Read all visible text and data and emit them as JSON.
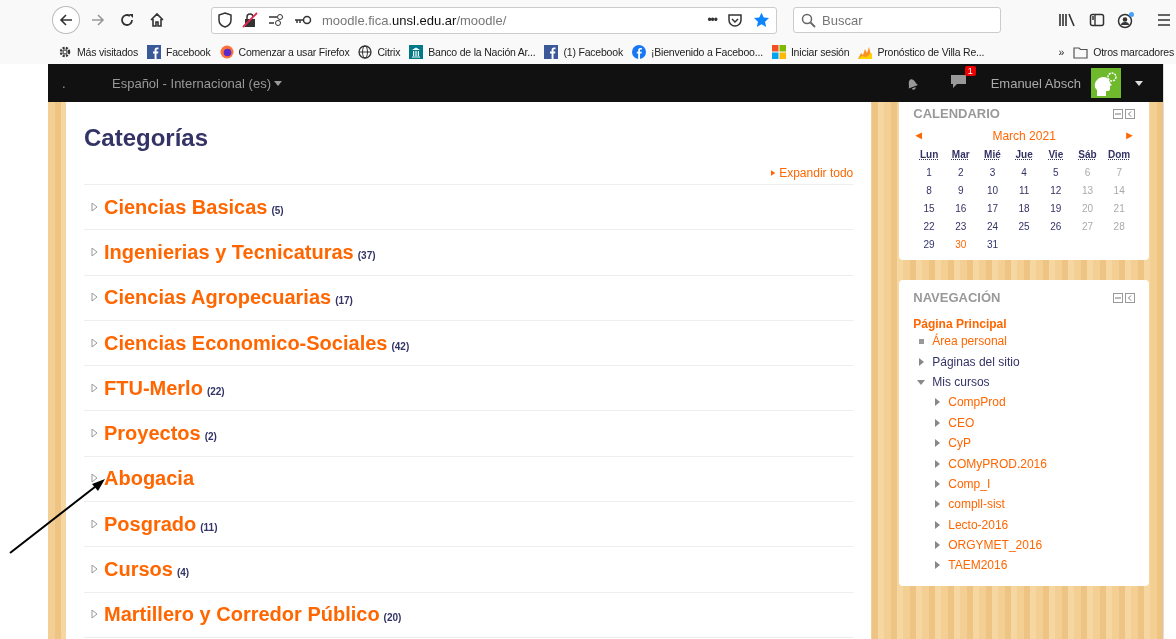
{
  "browser": {
    "url_host_pre": "moodle.fica.",
    "url_host_main": "unsl.edu.ar",
    "url_path": "/moodle/",
    "search_placeholder": "Buscar",
    "more": "•••",
    "bookmarks": [
      {
        "label": "Más visitados"
      },
      {
        "label": "Facebook"
      },
      {
        "label": "Comenzar a usar Firefox"
      },
      {
        "label": "Citrix"
      },
      {
        "label": "Banco de la Nación Ar..."
      },
      {
        "label": "(1) Facebook"
      },
      {
        "label": "¡Bienvenido a Faceboo..."
      },
      {
        "label": "Iniciar sesión"
      },
      {
        "label": "Pronóstico de Villa Re..."
      }
    ],
    "overflow": "»",
    "other_bookmarks": "Otros marcadores"
  },
  "navbar": {
    "brand": ".",
    "language": "Español - Internacional (es)",
    "message_count": "1",
    "user": "Emanuel Absch"
  },
  "main": {
    "title": "Categorías",
    "expand_all": "Expandir todo",
    "categories": [
      {
        "name": "Ciencias Basicas",
        "count": "(5)",
        "expanded": false
      },
      {
        "name": "Ingenierias y Tecnicaturas",
        "count": "(37)",
        "expanded": false
      },
      {
        "name": "Ciencias Agropecuarias",
        "count": "(17)",
        "expanded": false
      },
      {
        "name": "Ciencias Economico-Sociales",
        "count": "(42)",
        "expanded": false
      },
      {
        "name": "FTU-Merlo",
        "count": "(22)",
        "expanded": false
      },
      {
        "name": "Proyectos",
        "count": "(2)",
        "expanded": false
      },
      {
        "name": "Abogacia",
        "expanded": false
      },
      {
        "name": "Posgrado",
        "count": "(11)",
        "expanded": false
      },
      {
        "name": "Cursos",
        "count": "(4)",
        "expanded": false
      },
      {
        "name": "Martillero y Corredor Público",
        "count": "(20)",
        "expanded": false
      }
    ]
  },
  "calendar": {
    "title": "CALENDARIO",
    "prev": "◄",
    "next": "►",
    "month": "March 2021",
    "weekdays": [
      "Lun",
      "Mar",
      "Mié",
      "Jue",
      "Vie",
      "Sáb",
      "Dom"
    ],
    "weeks": [
      [
        {
          "day": "1",
          "kind": "weekday"
        },
        {
          "day": "2",
          "kind": "weekday"
        },
        {
          "day": "3",
          "kind": "weekday"
        },
        {
          "day": "4",
          "kind": "weekday"
        },
        {
          "day": "5",
          "kind": "weekday"
        },
        {
          "day": "6",
          "kind": "weekend"
        },
        {
          "day": "7",
          "kind": "weekend"
        }
      ],
      [
        {
          "day": "8",
          "kind": "weekday"
        },
        {
          "day": "9",
          "kind": "weekday"
        },
        {
          "day": "10",
          "kind": "weekday"
        },
        {
          "day": "11",
          "kind": "weekday"
        },
        {
          "day": "12",
          "kind": "weekday"
        },
        {
          "day": "13",
          "kind": "weekend"
        },
        {
          "day": "14",
          "kind": "weekend"
        }
      ],
      [
        {
          "day": "15",
          "kind": "weekday"
        },
        {
          "day": "16",
          "kind": "weekday"
        },
        {
          "day": "17",
          "kind": "weekday"
        },
        {
          "day": "18",
          "kind": "weekday"
        },
        {
          "day": "19",
          "kind": "weekday"
        },
        {
          "day": "20",
          "kind": "weekend"
        },
        {
          "day": "21",
          "kind": "weekend"
        }
      ],
      [
        {
          "day": "22",
          "kind": "weekday"
        },
        {
          "day": "23",
          "kind": "weekday"
        },
        {
          "day": "24",
          "kind": "weekday"
        },
        {
          "day": "25",
          "kind": "weekday"
        },
        {
          "day": "26",
          "kind": "weekday"
        },
        {
          "day": "27",
          "kind": "weekend"
        },
        {
          "day": "28",
          "kind": "weekend"
        }
      ],
      [
        {
          "day": "29",
          "kind": "weekday"
        },
        {
          "day": "30",
          "kind": "today"
        },
        {
          "day": "31",
          "kind": "weekday"
        }
      ]
    ]
  },
  "navigation": {
    "title": "NAVEGACIÓN",
    "home": "Página Principal",
    "items": [
      {
        "label": "Área personal",
        "kind": "leaf"
      },
      {
        "label": "Páginas del sitio",
        "kind": "branch",
        "expanded": false
      },
      {
        "label": "Mis cursos",
        "kind": "branch",
        "expanded": true,
        "children": [
          {
            "label": "CompProd",
            "kind": "course",
            "expanded": false
          },
          {
            "label": "CEO",
            "kind": "course",
            "expanded": false
          },
          {
            "label": "CyP",
            "kind": "course",
            "expanded": false
          },
          {
            "label": "COMyPROD.2016",
            "kind": "course",
            "expanded": false
          },
          {
            "label": "Comp_I",
            "kind": "course",
            "expanded": false
          },
          {
            "label": "compll-sist",
            "kind": "course",
            "expanded": false
          },
          {
            "label": "Lecto-2016",
            "kind": "course",
            "expanded": false
          },
          {
            "label": "ORGYMET_2016",
            "kind": "course",
            "expanded": false
          },
          {
            "label": "TAEM2016",
            "kind": "course",
            "expanded": false
          }
        ]
      }
    ]
  }
}
